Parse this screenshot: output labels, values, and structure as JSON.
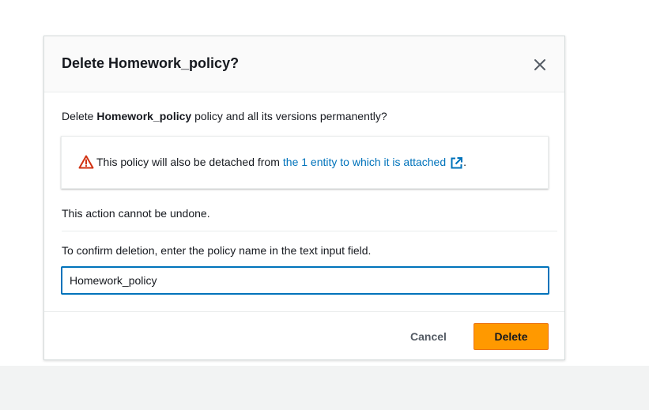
{
  "modal": {
    "title": "Delete Homework_policy?",
    "close_icon": "close-icon",
    "intro_prefix": "Delete ",
    "intro_policy_name": "Homework_policy",
    "intro_suffix": " policy and all its versions permanently?",
    "alert": {
      "icon": "warning-icon",
      "text": "This policy will also be detached from",
      "link_text": "the 1 entity to which it is attached",
      "link_icon": "external-link-icon",
      "trailing": "."
    },
    "undo_warning": "This action cannot be undone.",
    "confirm_instruction": "To confirm deletion, enter the policy name in the text input field.",
    "confirm_input_value": "Homework_policy",
    "cancel_label": "Cancel",
    "delete_label": "Delete"
  },
  "colors": {
    "primary_button": "#ff9900",
    "link": "#0073bb",
    "input_focus_border": "#0073bb",
    "warning": "#d13212",
    "text": "#16191f",
    "secondary_text": "#545b64"
  }
}
